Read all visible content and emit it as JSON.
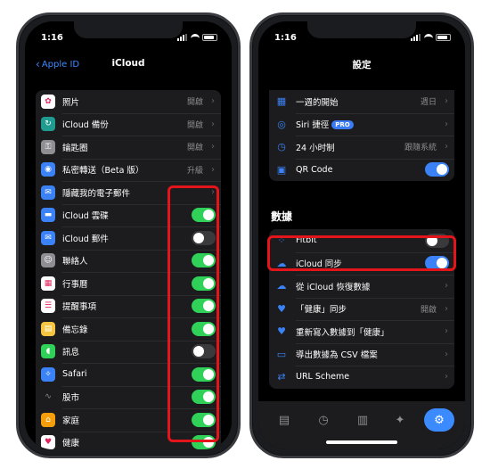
{
  "left_phone": {
    "time": "1:16",
    "nav": {
      "back_label": "Apple ID",
      "title": "iCloud"
    },
    "rows": [
      {
        "label": "照片",
        "value": "開啟",
        "icon": "photos-icon",
        "color": "#ffffff"
      },
      {
        "label": "iCloud 備份",
        "value": "開啟",
        "icon": "backup-icon",
        "color": "#1f9c8f"
      },
      {
        "label": "鑰匙圈",
        "value": "開啟",
        "icon": "keychain-icon",
        "color": "#8e8e93"
      },
      {
        "label": "私密轉送（Beta 版）",
        "value": "升級",
        "icon": "private-relay-icon",
        "color": "#3b82f6"
      },
      {
        "label": "隱藏我的電子郵件",
        "value": "",
        "icon": "hide-email-icon",
        "color": "#3b82f6"
      },
      {
        "label": "iCloud 雲碟",
        "toggle": true,
        "icon": "folder-icon",
        "color": "#3b82f6"
      },
      {
        "label": "iCloud 郵件",
        "toggle": false,
        "icon": "mail-icon",
        "color": "#3b82f6"
      },
      {
        "label": "聯絡人",
        "toggle": true,
        "icon": "contacts-icon",
        "color": "#8e8e93"
      },
      {
        "label": "行事曆",
        "toggle": true,
        "icon": "calendar-icon",
        "color": "#ffffff"
      },
      {
        "label": "提醒事項",
        "toggle": true,
        "icon": "reminders-icon",
        "color": "#ffffff"
      },
      {
        "label": "備忘錄",
        "toggle": true,
        "icon": "notes-icon",
        "color": "#f5c542"
      },
      {
        "label": "訊息",
        "toggle": false,
        "icon": "messages-icon",
        "color": "#30d158"
      },
      {
        "label": "Safari",
        "toggle": true,
        "icon": "safari-icon",
        "color": "#3b82f6"
      },
      {
        "label": "股市",
        "toggle": true,
        "icon": "stocks-icon",
        "color": "#1c1c1e"
      },
      {
        "label": "家庭",
        "toggle": true,
        "icon": "home-icon",
        "color": "#f59e0b"
      },
      {
        "label": "健康",
        "toggle": true,
        "icon": "health-icon",
        "color": "#ffffff"
      }
    ]
  },
  "right_phone": {
    "time": "1:16",
    "nav": {
      "title": "設定"
    },
    "general_rows": [
      {
        "label": "一週的開始",
        "value": "週日",
        "icon": "calendar-week-icon",
        "color": "#3b82f6"
      },
      {
        "label": "Siri 捷徑",
        "badge": "PRO",
        "value": "",
        "icon": "siri-shortcut-icon",
        "color": "#3b82f6"
      },
      {
        "label": "24 小时制",
        "value": "跟隨系統",
        "icon": "clock-24-icon",
        "color": "#3b82f6"
      },
      {
        "label": "QR Code",
        "toggle": true,
        "icon": "qr-code-icon",
        "color": "#3b82f6"
      }
    ],
    "section_title": "數據",
    "data_rows": [
      {
        "label": "Fitbit",
        "toggle": false,
        "icon": "fitbit-icon",
        "color": "#3b82f6"
      },
      {
        "label": "iCloud 同步",
        "toggle": true,
        "icon": "cloud-icon",
        "color": "#3b82f6"
      },
      {
        "label": "從 iCloud 恢復數據",
        "value": "",
        "icon": "cloud-restore-icon",
        "color": "#3b82f6"
      },
      {
        "label": "「健康」同步",
        "value": "開啟",
        "icon": "heart-icon",
        "color": "#3b82f6"
      },
      {
        "label": "重新寫入數據到「健康」",
        "value": "",
        "icon": "heart-rewrite-icon",
        "color": "#3b82f6"
      },
      {
        "label": "導出數據為 CSV 檔案",
        "value": "",
        "icon": "csv-icon",
        "color": "#3b82f6"
      },
      {
        "label": "URL Scheme",
        "value": "",
        "icon": "url-scheme-icon",
        "color": "#3b82f6"
      }
    ],
    "tabs": [
      {
        "icon": "clipboard-tab-icon"
      },
      {
        "icon": "clock-tab-icon"
      },
      {
        "icon": "trash-tab-icon"
      },
      {
        "icon": "figure-tab-icon"
      },
      {
        "icon": "gear-tab-icon",
        "active": true
      }
    ]
  },
  "colors": {
    "accent_blue": "#3b8bff",
    "toggle_green": "#30d158",
    "highlight_red": "#e3151a"
  }
}
